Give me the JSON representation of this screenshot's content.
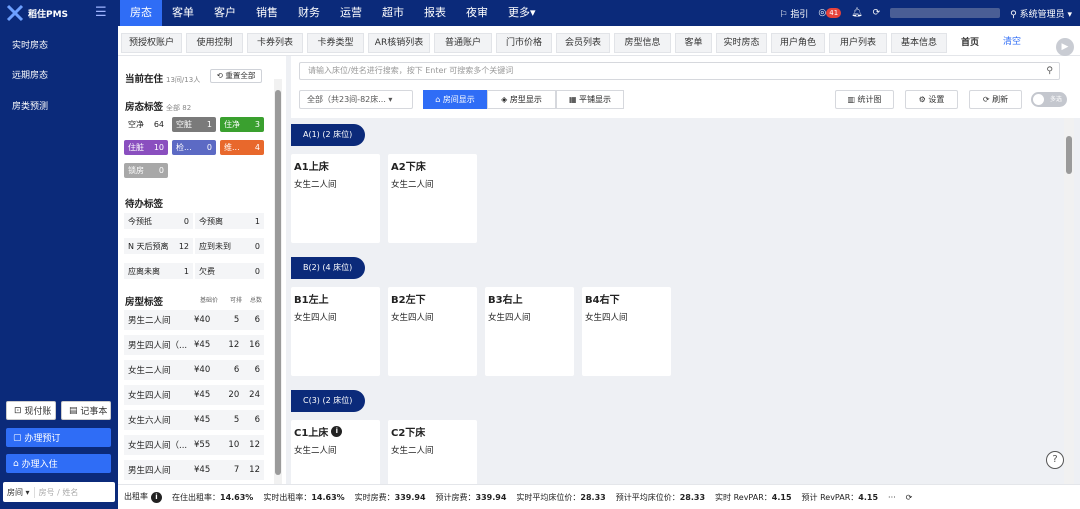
{
  "brand": {
    "name": "稻住PMS"
  },
  "nav": [
    "房态",
    "客单",
    "客户",
    "销售",
    "财务",
    "运营",
    "超市",
    "报表",
    "夜审",
    "更多▾"
  ],
  "topright": {
    "guide": "指引",
    "count": "41",
    "user": "系统管理员"
  },
  "sidebar": {
    "items": [
      "实时房态",
      "远期房态",
      "房类预测"
    ],
    "buttons": {
      "cash": "现付账",
      "notebook": "记事本",
      "booking": "办理预订",
      "checkin": "办理入住"
    },
    "search": {
      "type": "房间",
      "placeholder": "房号 / 姓名"
    }
  },
  "tabs": [
    "预授权账户",
    "使用控制",
    "卡券列表",
    "卡券类型",
    "AR核销列表",
    "普通账户",
    "门市价格",
    "会员列表",
    "房型信息",
    "客单",
    "实时房态",
    "用户角色",
    "用户列表",
    "基本信息",
    "首页",
    "清空"
  ],
  "left": {
    "current": {
      "title": "当前在住",
      "count": "13间/13人",
      "reset": "重置全部"
    },
    "roomStatus": {
      "title": "房态标签",
      "sub": "全部 82",
      "items": [
        {
          "label": "空净",
          "value": "64",
          "bg": "#ffffff",
          "fg": "#222"
        },
        {
          "label": "空脏",
          "value": "1",
          "bg": "#7a7a7a",
          "fg": "#fff"
        },
        {
          "label": "住净",
          "value": "3",
          "bg": "#3aa02f",
          "fg": "#fff"
        },
        {
          "label": "住脏",
          "value": "10",
          "bg": "#8a4fbf",
          "fg": "#fff"
        },
        {
          "label": "检...",
          "value": "0",
          "bg": "#5c6ac4",
          "fg": "#fff"
        },
        {
          "label": "维...",
          "value": "4",
          "bg": "#e8682c",
          "fg": "#fff"
        },
        {
          "label": "锁房",
          "value": "0",
          "bg": "#a8a8a8",
          "fg": "#fff"
        }
      ]
    },
    "todo": {
      "title": "待办标签",
      "items": [
        {
          "label": "今预抵",
          "value": "0"
        },
        {
          "label": "今预离",
          "value": "1"
        },
        {
          "label": "N 天后预离",
          "value": "12"
        },
        {
          "label": "应到未到",
          "value": "0"
        },
        {
          "label": "应离未离",
          "value": "1"
        },
        {
          "label": "欠费",
          "value": "0"
        }
      ]
    },
    "roomTypes": {
      "title": "房型标签",
      "cols": [
        "基础价",
        "可排",
        "总数"
      ],
      "rows": [
        {
          "name": "男生二人间",
          "price": "¥40",
          "avail": "5",
          "total": "6"
        },
        {
          "name": "男生四人间（...",
          "price": "¥45",
          "avail": "12",
          "total": "16"
        },
        {
          "name": "女生二人间",
          "price": "¥40",
          "avail": "6",
          "total": "6"
        },
        {
          "name": "女生四人间",
          "price": "¥45",
          "avail": "20",
          "total": "24"
        },
        {
          "name": "女生六人间",
          "price": "¥45",
          "avail": "5",
          "total": "6"
        },
        {
          "name": "女生四人间（...",
          "price": "¥55",
          "avail": "10",
          "total": "12"
        },
        {
          "name": "男生四人间",
          "price": "¥45",
          "avail": "7",
          "total": "12"
        }
      ]
    }
  },
  "toolbar": {
    "search_placeholder": "请输入床位/姓名进行搜索，按下 Enter 可搜索多个关键词",
    "filter": "全部（共23间-82床...",
    "views": [
      "房间显示",
      "房型显示",
      "平铺显示"
    ],
    "chart": "统计图",
    "settings": "设置",
    "refresh": "刷新",
    "multi": "多选"
  },
  "groups": [
    {
      "label": "A(1) (2 床位)",
      "beds": [
        {
          "name": "A1上床",
          "type": "女生二人间"
        },
        {
          "name": "A2下床",
          "type": "女生二人间"
        }
      ]
    },
    {
      "label": "B(2) (4 床位)",
      "beds": [
        {
          "name": "B1左上",
          "type": "女生四人间"
        },
        {
          "name": "B2左下",
          "type": "女生四人间"
        },
        {
          "name": "B3右上",
          "type": "女生四人间"
        },
        {
          "name": "B4右下",
          "type": "女生四人间"
        }
      ]
    },
    {
      "label": "C(3) (2 床位)",
      "beds": [
        {
          "name": "C1上床",
          "type": "女生二人间",
          "info": true
        },
        {
          "name": "C2下床",
          "type": "女生二人间"
        }
      ]
    }
  ],
  "statusbar": [
    {
      "label": "出租率",
      "value": ""
    },
    {
      "label": "在住出租率：",
      "value": "14.63%"
    },
    {
      "label": "实时出租率：",
      "value": "14.63%"
    },
    {
      "label": "实时房费：",
      "value": "339.94"
    },
    {
      "label": "预计房费：",
      "value": "339.94"
    },
    {
      "label": "实时平均床位价：",
      "value": "28.33"
    },
    {
      "label": "预计平均床位价：",
      "value": "28.33"
    },
    {
      "label": "实时 RevPAR：",
      "value": "4.15"
    },
    {
      "label": "预计 RevPAR：",
      "value": "4.15"
    }
  ]
}
